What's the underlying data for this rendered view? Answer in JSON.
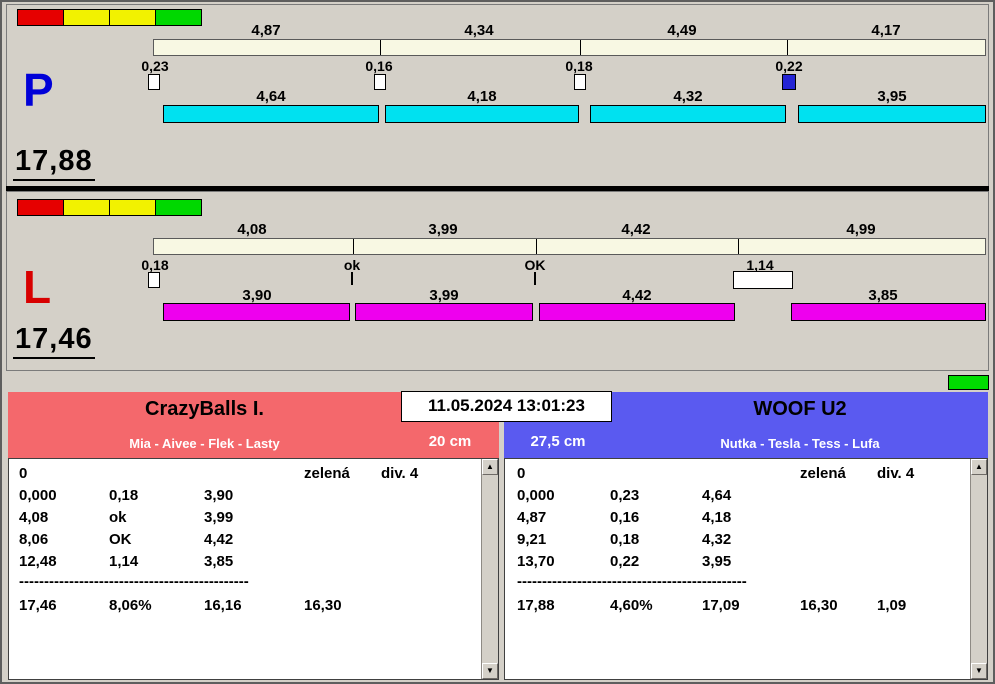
{
  "datetime": "11.05.2024 13:01:23",
  "icons": {
    "scroll_up": "▲",
    "scroll_down": "▼"
  },
  "colors": {
    "window_bg": "#d4d0c8",
    "split_bar": "#f8f8e3",
    "lane_p_bar": "#00e1f0",
    "lane_l_bar": "#ee00ee",
    "lane_p_letter": "#0000d8",
    "lane_l_letter": "#d80000",
    "team_left_header": "#f4686c",
    "team_right_header": "#5a5af0",
    "light_red": "#e60000",
    "light_yellow": "#f2f200",
    "light_green": "#00d800",
    "indicator_blue": "#2424d4",
    "green_marker": "#00dc00"
  },
  "lanes": [
    {
      "lane_letter": "P",
      "total_time": "17,88",
      "split_segments": [
        "4,87",
        "4,34",
        "4,49",
        "4,17"
      ],
      "cross_times": [
        "0,23",
        "0,16",
        "0,18",
        "0,22"
      ],
      "dog_times": [
        "4,64",
        "4,18",
        "4,32",
        "3,95"
      ]
    },
    {
      "lane_letter": "L",
      "total_time": "17,46",
      "split_segments": [
        "4,08",
        "3,99",
        "4,42",
        "4,99"
      ],
      "cross_times": [
        "0,18",
        "ok",
        "OK",
        "1,14"
      ],
      "dog_times": [
        "3,90",
        "3,99",
        "4,42",
        "3,85"
      ]
    }
  ],
  "teams": [
    {
      "name": "CrazyBalls I.",
      "lineup": "Mia - Aivee - Flek - Lasty",
      "jump_height": "20 cm",
      "info": {
        "start": "0",
        "color": "zelená",
        "division": "div. 4"
      },
      "rows": [
        [
          "0,000",
          "0,18",
          "3,90"
        ],
        [
          "4,08",
          "ok",
          "3,99"
        ],
        [
          "8,06",
          "OK",
          "4,42"
        ],
        [
          "12,48",
          "1,14",
          "3,85"
        ]
      ],
      "separator": "----------------------------------------------",
      "summary": [
        "17,46",
        "8,06%",
        "16,16",
        "16,30",
        ""
      ]
    },
    {
      "name": "WOOF U2",
      "lineup": "Nutka - Tesla - Tess - Lufa",
      "jump_height": "27,5 cm",
      "info": {
        "start": "0",
        "color": "zelená",
        "division": "div. 4"
      },
      "rows": [
        [
          "0,000",
          "0,23",
          "4,64"
        ],
        [
          "4,87",
          "0,16",
          "4,18"
        ],
        [
          "9,21",
          "0,18",
          "4,32"
        ],
        [
          "13,70",
          "0,22",
          "3,95"
        ]
      ],
      "separator": "----------------------------------------------",
      "summary": [
        "17,88",
        "4,60%",
        "17,09",
        "16,30",
        "1,09"
      ]
    }
  ]
}
